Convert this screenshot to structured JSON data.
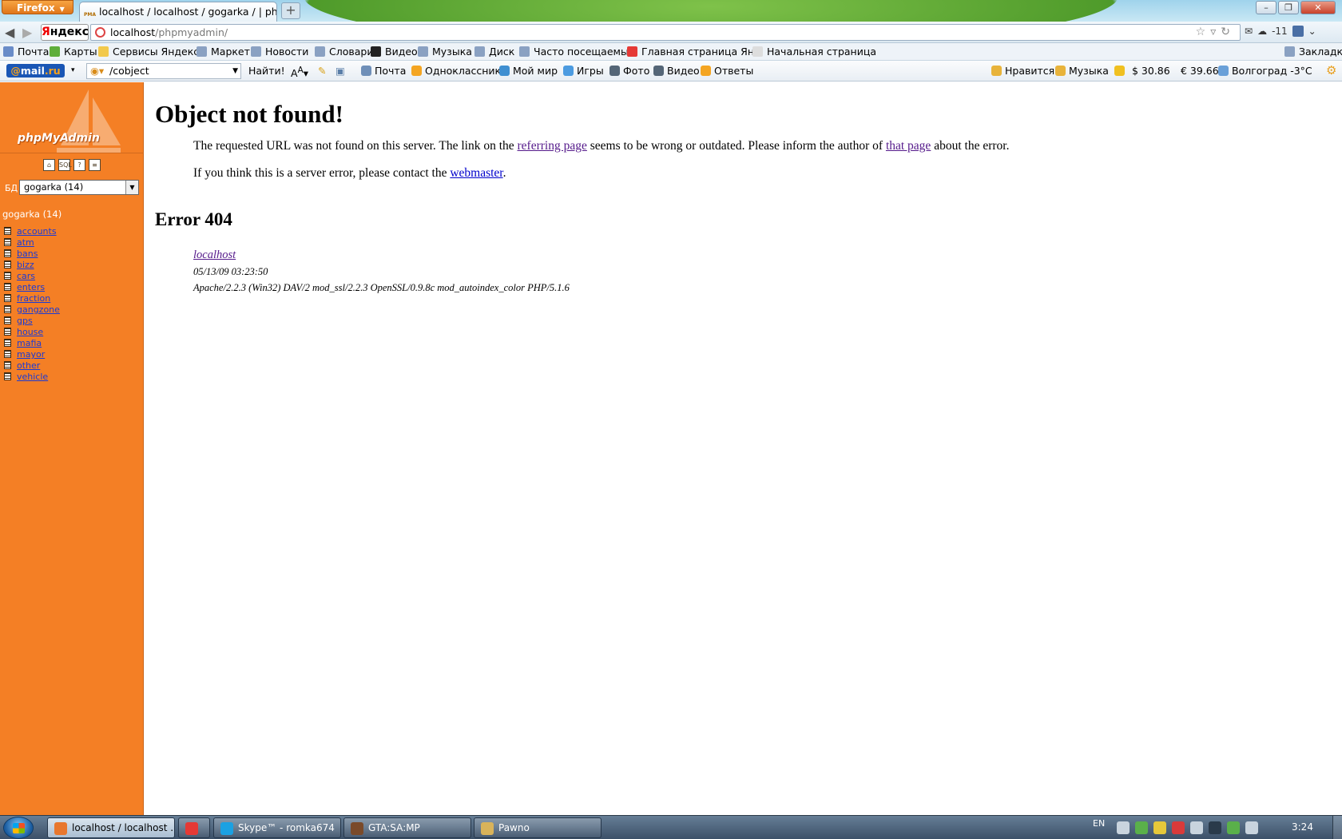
{
  "browser": {
    "firefox_button": "Firefox",
    "tab_title": "localhost / localhost / gogarka / | phpM...",
    "tab_favicon_text": "PMA",
    "new_tab": "+",
    "url_host": "localhost",
    "url_path": "/phpmyadmin/",
    "yandex_logo_first": "Я",
    "yandex_logo_rest": "ндекс",
    "weather_temp": "-11"
  },
  "bookmarks": [
    {
      "label": "Почта",
      "icon_color": "#6a8cc8",
      "icon": "mail-icon"
    },
    {
      "label": "Карты",
      "icon_color": "#5fae3b",
      "icon": "maps-icon"
    },
    {
      "label": "Сервисы Яндекса",
      "icon_color": "#f2c94c",
      "icon": "folder-icon"
    },
    {
      "label": "Маркет",
      "icon_color": "#8aa1c2",
      "icon": "market-icon"
    },
    {
      "label": "Новости",
      "icon_color": "#8aa1c2",
      "icon": "news-icon"
    },
    {
      "label": "Словари",
      "icon_color": "#8aa1c2",
      "icon": "dictionary-icon"
    },
    {
      "label": "Видео",
      "icon_color": "#222222",
      "icon": "video-icon"
    },
    {
      "label": "Музыка",
      "icon_color": "#8aa1c2",
      "icon": "music-icon"
    },
    {
      "label": "Диск",
      "icon_color": "#8aa1c2",
      "icon": "disk-icon"
    },
    {
      "label": "Часто посещаемые",
      "icon_color": "#8aa1c2",
      "icon": "frequent-icon"
    },
    {
      "label": "Главная страница Ян...",
      "icon_color": "#e53935",
      "icon": "yandex-icon"
    },
    {
      "label": "Начальная страница",
      "icon_color": "#dddddd",
      "icon": "page-icon"
    }
  ],
  "bookmarks_menu": "Закладки",
  "mailbar": {
    "logo_at": "@",
    "logo_text": "mail",
    "logo_tld": ".ru",
    "search_value": "/cobject",
    "search_button": "Найти!",
    "links": [
      {
        "label": "Почта",
        "icon": "envelope-icon",
        "icon_color": "#6f8fb8"
      },
      {
        "label": "Одноклассники",
        "icon": "odnoklassniki-icon",
        "icon_color": "#f4a522"
      },
      {
        "label": "Мой мир",
        "icon": "my-world-icon",
        "icon_color": "#3f8fd1"
      },
      {
        "label": "Игры",
        "icon": "games-icon",
        "icon_color": "#4c9be0"
      },
      {
        "label": "Фото",
        "icon": "photo-icon",
        "icon_color": "#556677"
      },
      {
        "label": "Видео",
        "icon": "video-icon",
        "icon_color": "#556677"
      },
      {
        "label": "Ответы",
        "icon": "answers-icon",
        "icon_color": "#f4a522"
      }
    ],
    "right": [
      {
        "label": "Нравится",
        "icon": "like-icon",
        "icon_color": "#e8b33a"
      },
      {
        "label": "Музыка",
        "icon": "music-icon",
        "icon_color": "#e8b33a"
      },
      {
        "label": "",
        "icon": "notes-icon",
        "icon_color": "#f0c020"
      },
      {
        "label": "$ 30.86",
        "icon": "dollar-icon",
        "icon_color": ""
      },
      {
        "label": "€ 39.66",
        "icon": "euro-icon",
        "icon_color": ""
      },
      {
        "label": "Волгоград -3°C",
        "icon": "snow-icon",
        "icon_color": "#6aa0d8"
      }
    ]
  },
  "pma": {
    "logo": "phpMyAdmin",
    "db_label": "БД",
    "db_select": "gogarka (14)",
    "db_heading": "gogarka (14)",
    "tables": [
      "accounts",
      "atm",
      "bans",
      "bizz",
      "cars",
      "enters",
      "fraction",
      "gangzone",
      "gps",
      "house",
      "mafia",
      "mayor",
      "other",
      "vehicle"
    ],
    "icons": [
      "home-icon",
      "sql-icon",
      "docs-icon",
      "query-icon"
    ]
  },
  "error": {
    "title": "Object not found!",
    "p1_a": "The requested URL was not found on this server. The link on the ",
    "p1_link1": "referring page",
    "p1_b": " seems to be wrong or outdated. Please inform the author of ",
    "p1_link2": "that page",
    "p1_c": " about the error.",
    "p2_a": "If you think this is a server error, please contact the ",
    "p2_link": "webmaster",
    "p2_b": ".",
    "code": "Error 404",
    "host": "localhost",
    "date": "05/13/09 03:23:50",
    "server": "Apache/2.2.3 (Win32) DAV/2 mod_ssl/2.2.3 OpenSSL/0.9.8c mod_autoindex_color PHP/5.1.6"
  },
  "taskbar": {
    "tasks": [
      {
        "label": "localhost / localhost ...",
        "active": true,
        "icon_color": "#e8772e"
      },
      {
        "label": "",
        "active": false,
        "icon_color": "#e53935"
      },
      {
        "label": "Skype™ - romka674",
        "active": false,
        "icon_color": "#1ba1e2"
      },
      {
        "label": "GTA:SA:MP",
        "active": false,
        "icon_color": "#7a4a2a"
      },
      {
        "label": "Pawno",
        "active": false,
        "icon_color": "#d9b35a"
      }
    ],
    "lang": "EN",
    "clock": "3:24",
    "tray_colors": [
      "#c9d4de",
      "#5ab04a",
      "#e6c83a",
      "#d93a3a",
      "#c9d4de",
      "#2a3a4a",
      "#5ab04a",
      "#c9d4de"
    ]
  }
}
